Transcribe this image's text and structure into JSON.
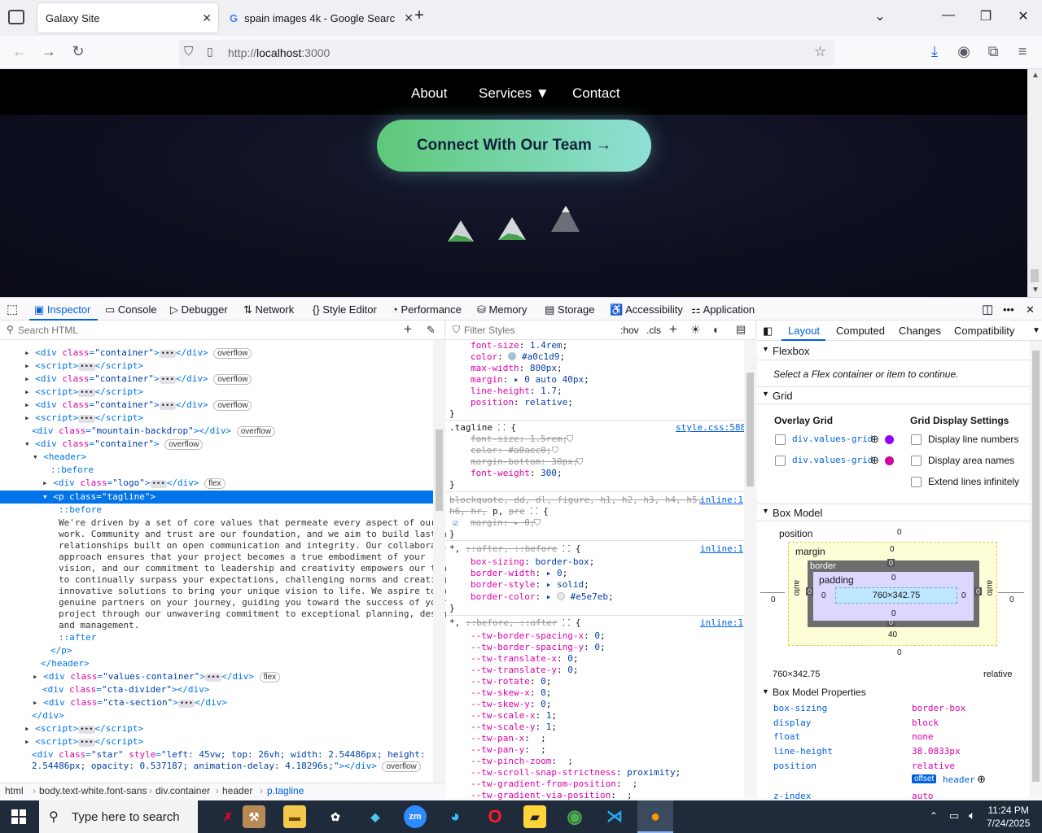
{
  "browser": {
    "tabs": [
      {
        "title": "Galaxy Site"
      },
      {
        "title": "spain images 4k - Google Searc"
      }
    ],
    "url_prefix": "http://",
    "url_host": "localhost",
    "url_port": ":3000"
  },
  "site": {
    "nav": [
      "About",
      "Services ▼",
      "Contact"
    ],
    "cta_label": "Connect With Our Team →"
  },
  "devtools": {
    "tabs": [
      "Inspector",
      "Console",
      "Debugger",
      "Network",
      "Style Editor",
      "Performance",
      "Memory",
      "Storage",
      "Accessibility",
      "Application"
    ],
    "search_placeholder": "Search HTML",
    "filter_placeholder": "Filter Styles",
    "hov": ":hov",
    "cls": ".cls",
    "breadcrumbs": [
      "html",
      "body.text-white.font-sans",
      "div.container",
      "header",
      "p.tagline"
    ],
    "tagline_text": [
      "We're driven by a set of core values that permeate every aspect of our",
      "work. Community and trust are our foundation, and we aim to build lasting",
      "relationships built on open communication and integrity. Our collaborative",
      "approach ensures that your project becomes a true embodiment of your",
      "vision, and our commitment to leadership and creativity empowers our team",
      "to continually surpass your expectations, challenging norms and creating",
      "innovative solutions to bring your unique vision to life. We aspire to be",
      "genuine partners on your journey, guiding you toward the success of your",
      "project through our unwavering commitment to exceptional planning, design,",
      "and management."
    ]
  },
  "layout_panel": {
    "tabs": [
      "Layout",
      "Computed",
      "Changes",
      "Compatibility"
    ],
    "flexbox_title": "Flexbox",
    "flexbox_hint": "Select a Flex container or item to continue.",
    "grid_title": "Grid",
    "overlay_grid": "Overlay Grid",
    "grid_settings": "Grid Display Settings",
    "grid_items": [
      "div.values-grid",
      "div.values-grid"
    ],
    "grid_colors": [
      "#9400ff",
      "#d1009e"
    ],
    "grid_options": [
      "Display line numbers",
      "Display area names",
      "Extend lines infinitely"
    ],
    "box_model_title": "Box Model",
    "content_size": "760×342.75",
    "summary_size": "760×342.75",
    "summary_position": "relative",
    "props_title": "Box Model Properties",
    "props": [
      {
        "k": "box-sizing",
        "v": "border-box"
      },
      {
        "k": "display",
        "v": "block"
      },
      {
        "k": "float",
        "v": "none"
      },
      {
        "k": "line-height",
        "v": "38.0833px"
      },
      {
        "k": "position",
        "v": "relative"
      },
      {
        "k": "z-index",
        "v": "auto"
      }
    ],
    "offset_badge": "offset",
    "offset_target": "header"
  },
  "taskbar": {
    "search_placeholder": "Type here to search",
    "time": "11:24 PM",
    "date": "7/24/2025"
  }
}
